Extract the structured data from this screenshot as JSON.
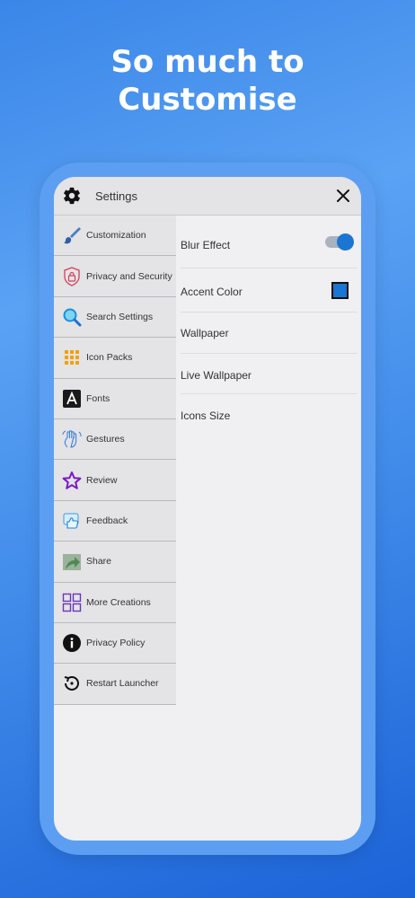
{
  "headline": {
    "line1": "So much to",
    "line2": "Customise"
  },
  "header": {
    "title": "Settings",
    "icon": "gear-icon",
    "close_icon": "close-icon"
  },
  "sidebar": {
    "items": [
      {
        "label": "Customization",
        "icon": "paintbrush-icon"
      },
      {
        "label": "Privacy and Security",
        "icon": "lock-icon"
      },
      {
        "label": "Search Settings",
        "icon": "search-icon"
      },
      {
        "label": "Icon Packs",
        "icon": "grid-dots-icon"
      },
      {
        "label": "Fonts",
        "icon": "font-icon"
      },
      {
        "label": "Gestures",
        "icon": "hand-icon"
      },
      {
        "label": "Review",
        "icon": "star-icon"
      },
      {
        "label": "Feedback",
        "icon": "thumbs-up-icon"
      },
      {
        "label": "Share",
        "icon": "share-arrow-icon"
      },
      {
        "label": "More Creations",
        "icon": "apps-grid-icon"
      },
      {
        "label": "Privacy Policy",
        "icon": "info-icon"
      },
      {
        "label": "Restart Launcher",
        "icon": "restart-icon"
      }
    ]
  },
  "content": {
    "blur_effect": {
      "label": "Blur Effect",
      "enabled": true
    },
    "accent_color": {
      "label": "Accent Color",
      "value": "#1a76d2"
    },
    "wallpaper": {
      "label": "Wallpaper"
    },
    "live_wallpaper": {
      "label": "Live Wallpaper"
    },
    "icons_size": {
      "label": "Icons Size"
    }
  },
  "colors": {
    "background": "#4a94ee",
    "accent": "#1a76d2",
    "panel": "#e4e3e6",
    "screen": "#f0eff1"
  }
}
